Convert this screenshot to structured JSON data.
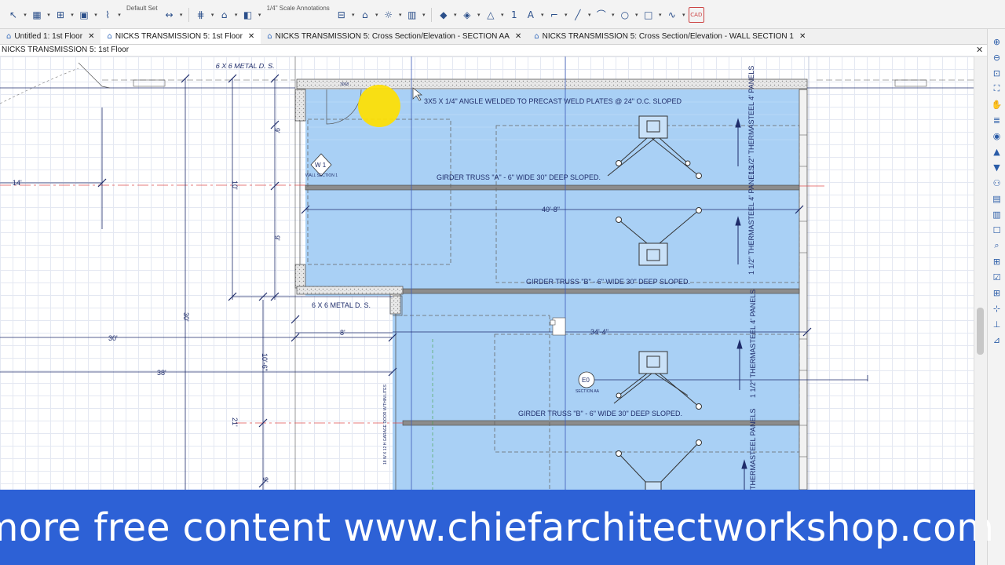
{
  "toolbar": {
    "layer_set_label": "Default Set",
    "scale_label": "1/4\" Scale Annotations",
    "counter_value": "1",
    "cad_label": "CAD",
    "buttons": [
      {
        "name": "select-objects-icon",
        "glyph": "↖"
      },
      {
        "name": "wall-tool-icon",
        "glyph": "▦"
      },
      {
        "name": "railing-icon",
        "glyph": "⊞"
      },
      {
        "name": "cabinet-icon",
        "glyph": "▣"
      },
      {
        "name": "stairs-icon",
        "glyph": "⌇"
      },
      {
        "name": "dimension-icon",
        "glyph": "↔"
      },
      {
        "name": "framing-icon",
        "glyph": "⋕"
      },
      {
        "name": "roof-icon",
        "glyph": "⌂"
      },
      {
        "name": "door-icon",
        "glyph": "◧"
      },
      {
        "name": "window-icon",
        "glyph": "⊟"
      },
      {
        "name": "room-icon",
        "glyph": "⌂"
      },
      {
        "name": "electrical-icon",
        "glyph": "☼"
      },
      {
        "name": "plan-footprint-icon",
        "glyph": "▥"
      },
      {
        "name": "terrain-icon",
        "glyph": "◆"
      },
      {
        "name": "library-icon",
        "glyph": "◈"
      },
      {
        "name": "shape-icon",
        "glyph": "△"
      },
      {
        "name": "text-tool-icon",
        "glyph": "A"
      },
      {
        "name": "callout-icon",
        "glyph": "⌐"
      },
      {
        "name": "cad-line-icon",
        "glyph": "╱"
      },
      {
        "name": "arc-icon",
        "glyph": "⌒"
      },
      {
        "name": "circle-icon",
        "glyph": "○"
      },
      {
        "name": "box-icon",
        "glyph": "□"
      },
      {
        "name": "spline-icon",
        "glyph": "∿"
      }
    ]
  },
  "tabs": [
    {
      "label": "Untitled 1: 1st Floor",
      "icon": "house-icon",
      "active": false
    },
    {
      "label": "NICKS TRANSMISSION 5: 1st Floor",
      "icon": "house-icon",
      "active": true
    },
    {
      "label": "NICKS TRANSMISSION 5: Cross Section/Elevation - SECTION AA",
      "icon": "elevation-icon",
      "active": false
    },
    {
      "label": "NICKS TRANSMISSION 5: Cross Section/Elevation - WALL SECTION 1",
      "icon": "elevation-icon",
      "active": false
    }
  ],
  "view": {
    "title": "NICKS TRANSMISSION 5: 1st Floor",
    "close_glyph": "✕"
  },
  "sidebar": {
    "buttons": [
      {
        "name": "zoom-in-icon",
        "glyph": "⊕"
      },
      {
        "name": "zoom-out-icon",
        "glyph": "⊖"
      },
      {
        "name": "zoom-window-icon",
        "glyph": "⊡"
      },
      {
        "name": "fill-window-icon",
        "glyph": "⛶"
      },
      {
        "name": "pan-icon",
        "glyph": "✋"
      },
      {
        "name": "layer-icon",
        "glyph": "≣"
      },
      {
        "name": "camera-icon",
        "glyph": "◉"
      },
      {
        "name": "floor-up-icon",
        "glyph": "▲"
      },
      {
        "name": "floor-down-icon",
        "glyph": "▼"
      },
      {
        "name": "glasses-icon",
        "glyph": "⚇"
      },
      {
        "name": "elevation-view-icon",
        "glyph": "▤"
      },
      {
        "name": "section-view-icon",
        "glyph": "▥"
      },
      {
        "name": "select-icon",
        "glyph": "☐"
      },
      {
        "name": "find-icon",
        "glyph": "⌕"
      },
      {
        "name": "plan-view-icon",
        "glyph": "⊞"
      },
      {
        "name": "checkbox-icon",
        "glyph": "☑"
      },
      {
        "name": "grid-icon",
        "glyph": "⊞"
      },
      {
        "name": "snap-icon",
        "glyph": "⊹"
      },
      {
        "name": "ortho-icon",
        "glyph": "⊥"
      },
      {
        "name": "trace-icon",
        "glyph": "⊿"
      }
    ]
  },
  "drawing": {
    "labels": {
      "metal_door_top": "6 X 6 METAL D. S.",
      "metal_door_mid": "6 X 6 METAL D. S.",
      "angle_note": "3X5 X 1/4\" ANGLE WELDED TO PRECAST WELD PLATES @ 24\" O.C. SLOPED",
      "girder_a": "GIRDER TRUSS \"A\" - 6\" WIDE 30\" DEEP  SLOPED.",
      "girder_b1": "GIRDER TRUSS \"B\" - 6\" WIDE 30\" DEEP  SLOPED.",
      "girder_b2": "GIRDER TRUSS \"B\" - 6\" WIDE 30\" DEEP  SLOPED.",
      "dim_40_8": "40'-8\"",
      "dim_34_4": "34'-4\"",
      "dim_30a": "30'",
      "dim_30b": "30'",
      "dim_14": "14'",
      "dim_8": "8'",
      "dim_10_6": "10'-6\"",
      "dim_9a": "9'",
      "dim_9b": "9'",
      "dim_10": "10'",
      "dim_38": "38'",
      "dim_21": "21'",
      "dim_9c": "9'",
      "panel_1": "1 1/2\" THERMASTEEL 4' PANELS",
      "panel_2": "1 1/2\" THERMASTEEL 4' PANELS",
      "panel_3": "1 1/2\" THERMASTEEL 4' PANELS",
      "panel_4": "THERMASTEEL PANELS",
      "wall_section_marker": "W 1",
      "wall_section_caption": "WALL SECTION 1",
      "section_marker": "E0",
      "section_caption": "SECTION AA",
      "vert_note": "18 W X 12 H GARAGE DOOR W/THIN LITES",
      "window_tag": "3068"
    }
  },
  "banner": {
    "text": "more free content www.chiefarchitectworkshop.com"
  },
  "colors": {
    "slab_fill": "#a9d0f5",
    "cursor_highlight": "#ffe000",
    "banner_bg": "#2d61d6",
    "line_dark": "#1f2d6b",
    "red_line": "#e05050"
  }
}
